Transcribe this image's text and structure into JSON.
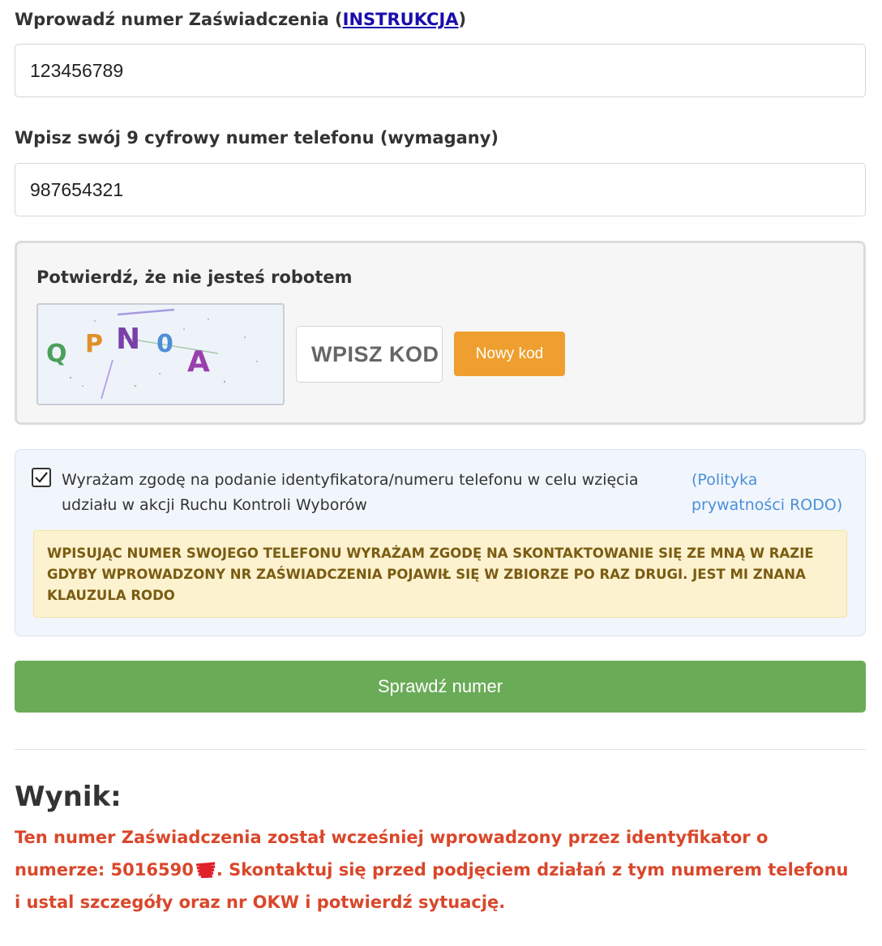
{
  "certificate": {
    "label": "Wprowadź numer Zaświadczenia (",
    "link": "INSTRUKCJA",
    "label_end": ")",
    "value": "123456789"
  },
  "phone": {
    "label": "Wpisz swój 9 cyfrowy numer telefonu (wymagany)",
    "value": "987654321"
  },
  "captcha": {
    "title": "Potwierdź, że nie jesteś robotem",
    "code_chars": [
      "Q",
      "P",
      "N",
      "0",
      "A"
    ],
    "input_placeholder": "WPISZ KOD",
    "new_code_label": "Nowy kod"
  },
  "consent": {
    "checked": true,
    "text": "Wyrażam zgodę na podanie identyfikatora/numeru telefonu w celu wzięcia udziału w akcji Ruchu Kontroli Wyborów",
    "privacy_link": "(Polityka prywatności RODO)",
    "warning": "WPISUJĄC NUMER SWOJEGO TELEFONU WYRAŻAM ZGODĘ NA SKONTAKTOWANIE SIĘ ZE MNĄ W RAZIE GDYBY WPROWADZONY NR ZAŚWIADCZENIA POJAWIŁ SIĘ W ZBIORZE PO RAZ DRUGI. JEST MI ZNANA KLAUZULA RODO"
  },
  "submit": {
    "label": "Sprawdź numer"
  },
  "result": {
    "heading": "Wynik:",
    "text_before": "Ten numer Zaświadczenia został wcześniej wprowadzony przez identyfikator o numerze: 5016590",
    "text_after": ". Skontaktuj się przed podjęciem działań z tym numerem telefonu i ustal szczegóły oraz nr OKW i potwierdź sytuację."
  },
  "colors": {
    "link": "#1a0dab",
    "new_code_button": "#ef9f2f",
    "submit_button": "#6aab58",
    "result_text": "#d9472b",
    "warning_bg": "#fcf2cf",
    "privacy_link": "#4a90d9"
  }
}
